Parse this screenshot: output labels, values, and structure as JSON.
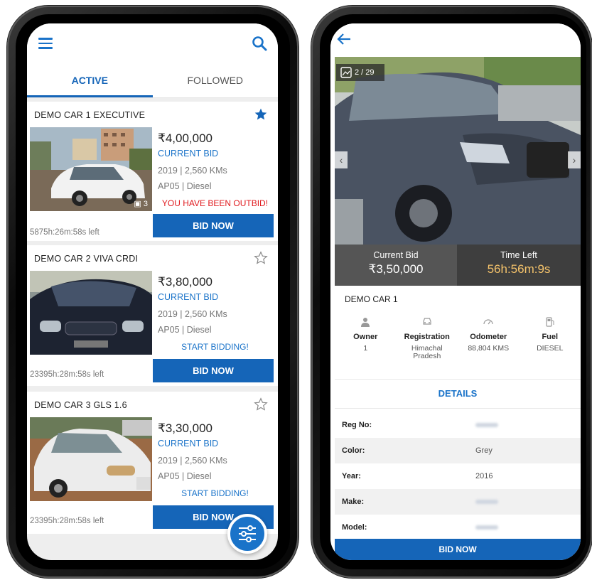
{
  "left_screen": {
    "tabs": [
      {
        "label": "ACTIVE"
      },
      {
        "label": "FOLLOWED"
      }
    ],
    "listings": [
      {
        "title": "DEMO CAR 1 EXECUTIVE",
        "price": "₹4,00,000",
        "bid_label": "CURRENT BID",
        "meta1": "2019 | 2,560 KMs",
        "meta2": "AP05 | Diesel",
        "status": "YOU HAVE BEEN OUTBID!",
        "status_color": "#e0191d",
        "time_left": "5875h:26m:58s left",
        "button": "BID NOW",
        "photo_count": "3",
        "followed": true
      },
      {
        "title": "DEMO CAR 2 VIVA CRDI",
        "price": "₹3,80,000",
        "bid_label": "CURRENT BID",
        "meta1": "2019 | 2,560 KMs",
        "meta2": "AP05 | Diesel",
        "status": "START BIDDING!",
        "status_color": "#1a73c9",
        "time_left": "23395h:28m:58s left",
        "button": "BID NOW",
        "followed": false
      },
      {
        "title": "DEMO CAR 3 GLS 1.6",
        "price": "₹3,30,000",
        "bid_label": "CURRENT BID",
        "meta1": "2019 | 2,560 KMs",
        "meta2": "AP05 | Diesel",
        "status": "START BIDDING!",
        "status_color": "#1a73c9",
        "time_left": "23395h:28m:58s left",
        "button": "BID NOW",
        "followed": false
      }
    ]
  },
  "right_screen": {
    "photo_counter": "2 / 29",
    "current_bid_label": "Current Bid",
    "current_bid": "₹3,50,000",
    "time_left_label": "Time Left",
    "time_left": "56h:56m:9s",
    "car_name": "DEMO CAR 1",
    "specs": [
      {
        "label": "Owner",
        "value": "1",
        "icon": "person-icon"
      },
      {
        "label": "Registration",
        "value": "Himachal Pradesh",
        "icon": "car-icon"
      },
      {
        "label": "Odometer",
        "value": "88,804 KMS",
        "icon": "gauge-icon"
      },
      {
        "label": "Fuel",
        "value": "DIESEL",
        "icon": "fuel-icon"
      }
    ],
    "details_title": "DETAILS",
    "details": [
      {
        "key": "Reg No:",
        "value": ""
      },
      {
        "key": "Color:",
        "value": "Grey"
      },
      {
        "key": "Year:",
        "value": "2016"
      },
      {
        "key": "Make:",
        "value": ""
      },
      {
        "key": "Model:",
        "value": ""
      }
    ],
    "bid_button": "BID NOW"
  },
  "colors": {
    "accent": "#1565b8",
    "time_left": "#f5c36b",
    "outbid": "#e0191d"
  }
}
